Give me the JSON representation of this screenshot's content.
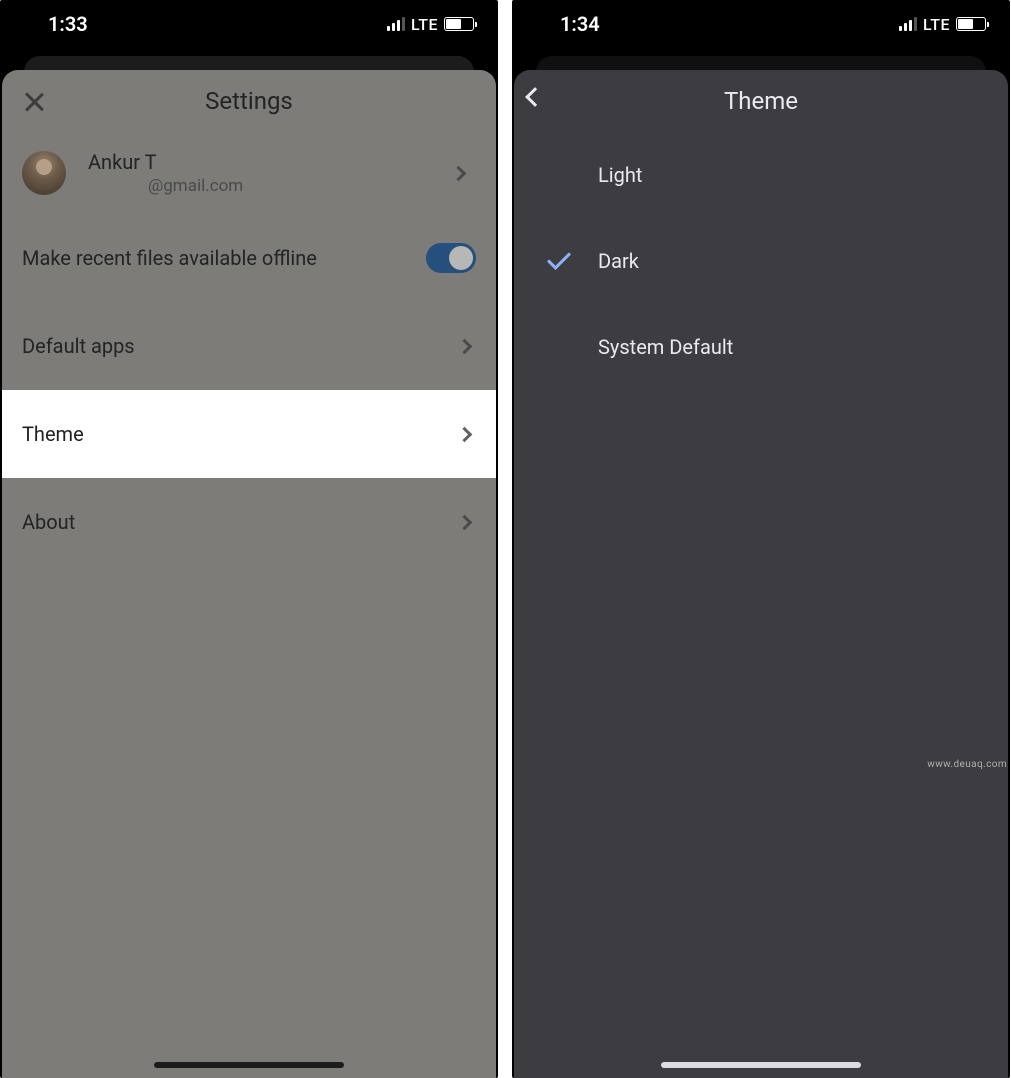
{
  "left": {
    "status": {
      "time": "1:33",
      "network": "LTE"
    },
    "sheet_title": "Settings",
    "account": {
      "name": "Ankur T",
      "email": "@gmail.com"
    },
    "rows": {
      "offline": "Make recent files available offline",
      "default_apps": "Default apps",
      "theme": "Theme",
      "about": "About"
    }
  },
  "right": {
    "status": {
      "time": "1:34",
      "network": "LTE"
    },
    "sheet_title": "Theme",
    "options": {
      "light": "Light",
      "dark": "Dark",
      "system": "System Default"
    },
    "selected": "dark"
  },
  "watermark": "www.deuaq.com"
}
